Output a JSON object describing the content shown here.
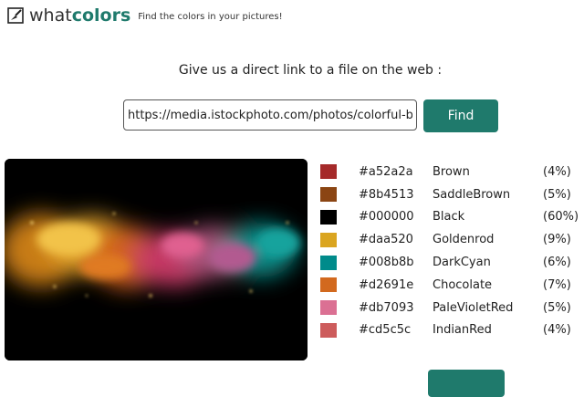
{
  "header": {
    "logo_what": "what",
    "logo_colors": "colors",
    "tagline": "Find the colors in your pictures!",
    "logo_icon": "brush-icon"
  },
  "main": {
    "prompt": "Give us a direct link to a file on the web :",
    "url_value": "https://media.istockphoto.com/photos/colorful-bac",
    "find_label": "Find"
  },
  "palette": [
    {
      "hex": "#a52a2a",
      "name": "Brown",
      "pct": "(4%)",
      "color": "#a52a2a"
    },
    {
      "hex": "#8b4513",
      "name": "SaddleBrown",
      "pct": "(5%)",
      "color": "#8b4513"
    },
    {
      "hex": "#000000",
      "name": "Black",
      "pct": "(60%)",
      "color": "#000000"
    },
    {
      "hex": "#daa520",
      "name": "Goldenrod",
      "pct": "(9%)",
      "color": "#daa520"
    },
    {
      "hex": "#008b8b",
      "name": "DarkCyan",
      "pct": "(6%)",
      "color": "#008b8b"
    },
    {
      "hex": "#d2691e",
      "name": "Chocolate",
      "pct": "(7%)",
      "color": "#d2691e"
    },
    {
      "hex": "#db7093",
      "name": "PaleVioletRed",
      "pct": "(5%)",
      "color": "#db7093"
    },
    {
      "hex": "#cd5c5c",
      "name": "IndianRed",
      "pct": "(4%)",
      "color": "#cd5c5c"
    }
  ],
  "colors": {
    "brand": "#1f7a6c"
  }
}
